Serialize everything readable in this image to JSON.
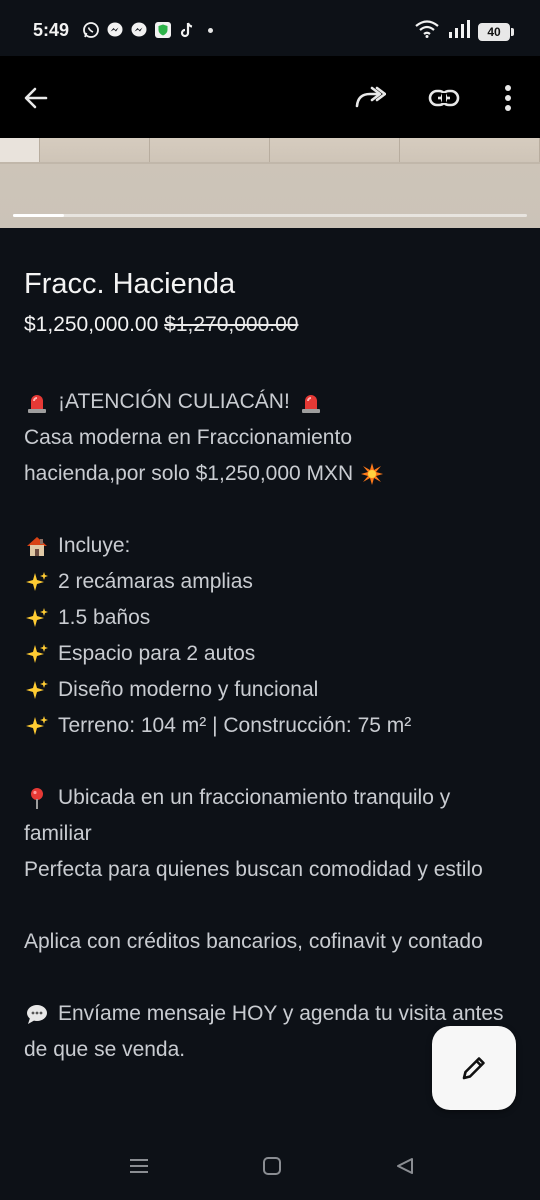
{
  "status_bar": {
    "time": "5:49",
    "battery_level": "40",
    "left_icons": [
      "whatsapp-icon",
      "messenger-icon",
      "messenger-icon",
      "shield-icon",
      "tiktok-icon",
      "dot"
    ],
    "right_icons": [
      "wifi-icon",
      "signal-icon",
      "battery-icon"
    ]
  },
  "app_bar": {
    "icons": [
      "back-arrow-icon",
      "share-forward-icon",
      "link-icon",
      "more-vert-icon"
    ]
  },
  "gallery": {
    "progress_fraction": 0.1
  },
  "listing": {
    "title": "Fracc. Hacienda",
    "price": "$1,250,000.00",
    "old_price": "$1,270,000.00",
    "description": {
      "l1": "¡ATENCIÓN CULIACÁN!",
      "l2": "Casa moderna en Fraccionamiento",
      "l3": "hacienda,por solo $1,250,000 MXN",
      "incluye": "Incluye:",
      "features": [
        "2 recámaras amplias",
        "1.5 baños",
        "Espacio para 2 autos",
        "Diseño moderno y funcional",
        "Terreno: 104 m² | Construcción: 75 m²"
      ],
      "location": "Ubicada en un fraccionamiento tranquilo y familiar",
      "perfecta": "Perfecta para quienes buscan comodidad y estilo",
      "aplica": "Aplica con créditos bancarios, cofinavit y contado",
      "cta": "Envíame mensaje HOY y agenda tu visita antes de que se venda."
    }
  },
  "colors": {
    "background": "#0d1117",
    "app_bar": "#000000",
    "text": "#c9ccd1",
    "fab": "#f7f7f7"
  },
  "nav_bar": {
    "icons": [
      "recents-icon",
      "home-icon",
      "back-icon"
    ]
  }
}
